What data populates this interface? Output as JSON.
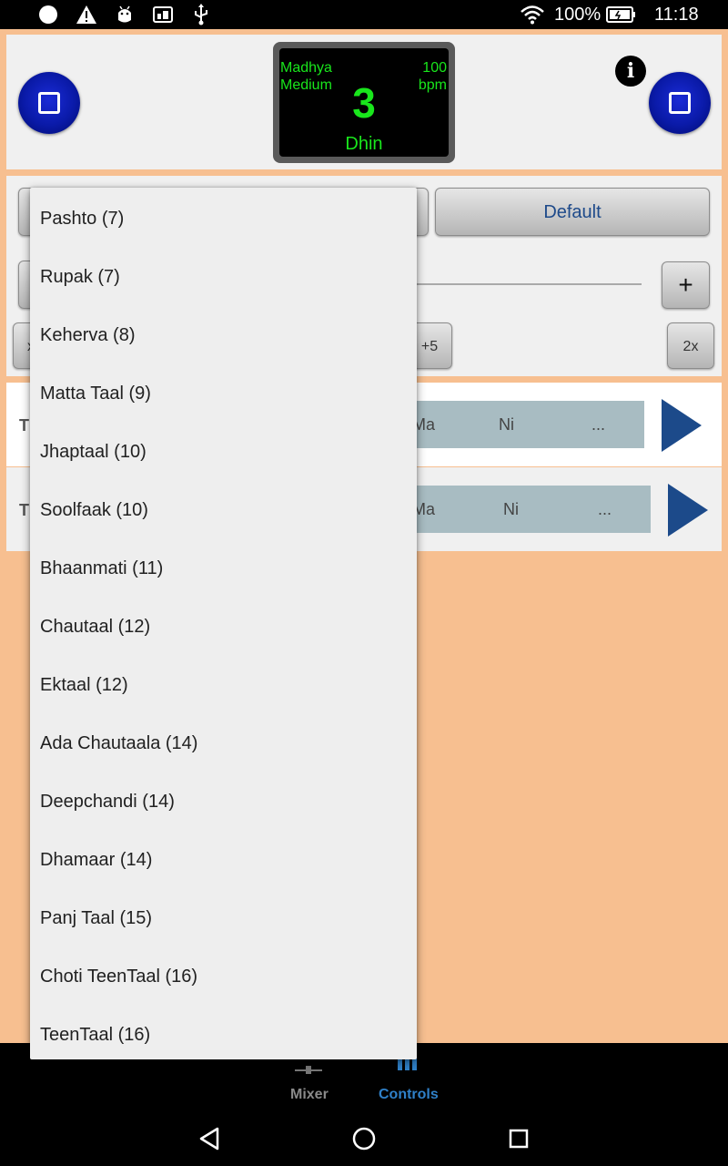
{
  "status_bar": {
    "battery": "100%",
    "time": "11:18",
    "icons": [
      "notification-dot-icon",
      "warning-icon",
      "android-debug-icon",
      "cast-icon",
      "usb-icon",
      "wifi-icon",
      "battery-icon"
    ]
  },
  "display": {
    "laya": "Madhya",
    "laya_en": "Medium",
    "tempo_value": "100",
    "tempo_unit": "bpm",
    "beat": "3",
    "bol": "Dhin"
  },
  "controls": {
    "default_label": "Default",
    "plus_label": "+",
    "plus5_label": "+5",
    "double_label": "2x",
    "minus_partial": "x"
  },
  "rows": [
    {
      "label_partial": "T",
      "swar": [
        "Ma",
        "Ni",
        "..."
      ]
    },
    {
      "label_partial": "T",
      "swar": [
        "Ma",
        "Ni",
        "..."
      ]
    }
  ],
  "bottom_tabs": {
    "mixer": "Mixer",
    "controls": "Controls",
    "active": "Controls"
  },
  "dropdown": {
    "items": [
      "Pashto (7)",
      "Rupak (7)",
      "Keherva (8)",
      "Matta Taal (9)",
      "Jhaptaal (10)",
      "Soolfaak (10)",
      "Bhaanmati (11)",
      "Chautaal (12)",
      "Ektaal (12)",
      "Ada Chautaala (14)",
      "Deepchandi (14)",
      "Dhamaar (14)",
      "Panj Taal (15)",
      "Choti TeenTaal (16)",
      "TeenTaal (16)"
    ]
  },
  "colors": {
    "background": "#f7bf90",
    "panel": "#f0f0f0",
    "display_text": "#19e61c",
    "play_button": "#1c4a8a",
    "active_tab": "#2f80c8",
    "default_text": "#1e4a8a"
  }
}
